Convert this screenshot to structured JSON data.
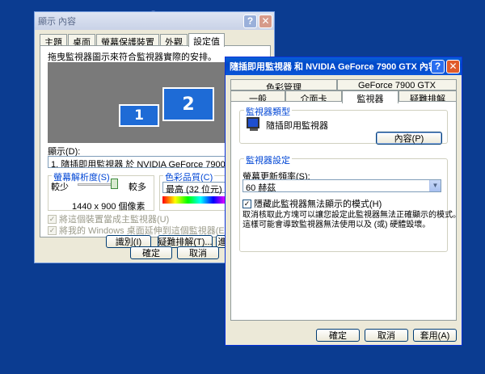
{
  "background": {
    "ghost_text": "2"
  },
  "display_window": {
    "title": "顯示 內容",
    "tabs": [
      "主題",
      "桌面",
      "螢幕保護裝置",
      "外觀",
      "設定值"
    ],
    "active_tab": "設定值",
    "instruction": "拖曳監視器圖示來符合監視器實際的安排。",
    "monitor1_label": "1",
    "monitor2_label": "2",
    "display_label": "顯示(D):",
    "display_value": "1. 隨插即用監視器 於 NVIDIA GeForce 7900 GTX",
    "resolution_group": "螢幕解析度(S)",
    "less_label": "較少",
    "more_label": "較多",
    "resolution_value": "1440 x 900 個像素",
    "resolution_fraction": 0.9,
    "color_group": "色彩品質(C)",
    "color_value": "最高 (32 位元)",
    "chk_primary": "將這個裝置當成主監視器(U)",
    "chk_extend": "將我的 Windows 桌面延伸到這個監視器(E)",
    "btn_identify": "識別(I)",
    "btn_troubleshoot": "疑難排解(T)...",
    "btn_advanced": "進",
    "btn_ok": "確定",
    "btn_cancel": "取消"
  },
  "monitor_window": {
    "title": "隨插即用監視器 和 NVIDIA GeForce 7900 GTX 內容",
    "tabs_row1": [
      "色彩管理",
      "GeForce 7900 GTX"
    ],
    "tabs_row2": [
      "一般",
      "介面卡",
      "監視器",
      "疑難排解"
    ],
    "active_tab": "監視器",
    "monitor_type_group": "監視器類型",
    "monitor_name": "隨插即用監視器",
    "btn_properties": "內容(P)",
    "settings_group": "監視器設定",
    "refresh_label": "螢幕更新頻率(S):",
    "refresh_value": "60 赫茲",
    "hide_modes_label": "隱藏此監視器無法顯示的模式(H)",
    "hide_modes_checked": true,
    "hide_modes_desc1": "取消核取此方塊可以讓您設定此監視器無法正確顯示的模式。",
    "hide_modes_desc2": "這樣可能會導致監視器無法使用以及 (或) 硬體毀壞。",
    "btn_ok": "確定",
    "btn_cancel": "取消",
    "btn_apply": "套用(A)"
  }
}
